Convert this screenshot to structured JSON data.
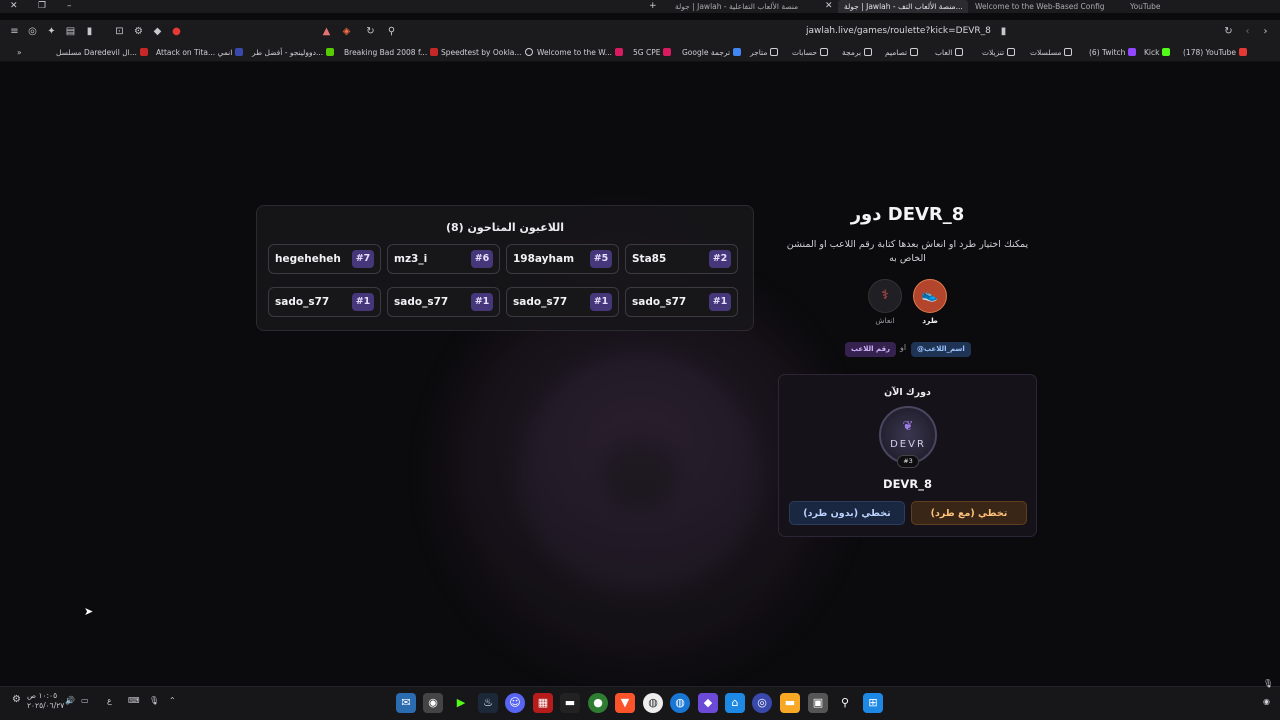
{
  "browser": {
    "tabs": [
      {
        "label": "YouTube",
        "active": false
      },
      {
        "label": "Welcome to the Web-Based Config...",
        "active": false
      },
      {
        "label": "جولة | Jawlah - منصة الألعاب التف...",
        "active": true
      },
      {
        "label": "جولة | Jawlah - منصة الألعاب التفاعلية",
        "active": false
      }
    ],
    "new_tab": "+",
    "url": "jawlah.live/games/roulette?kick=DEVR_8",
    "bookmarks": [
      {
        "label": "(178) YouTube",
        "color": "#e53935"
      },
      {
        "label": "Kick",
        "color": "#53fc18"
      },
      {
        "label": "(6) Twitch",
        "color": "#9146ff"
      },
      {
        "label": "مسلسلات",
        "color": "#cfcfd4"
      },
      {
        "label": "تنزيلات",
        "color": "#cfcfd4"
      },
      {
        "label": "العاب",
        "color": "#cfcfd4"
      },
      {
        "label": "تصاميم",
        "color": "#cfcfd4"
      },
      {
        "label": "برمجة",
        "color": "#cfcfd4"
      },
      {
        "label": "حسابات",
        "color": "#cfcfd4"
      },
      {
        "label": "متاجر",
        "color": "#cfcfd4"
      },
      {
        "label": "Google ترجمة",
        "color": "#4285f4"
      },
      {
        "label": "5G CPE",
        "color": "#d81b60"
      },
      {
        "label": "Welcome to the W...",
        "color": "#d81b60"
      },
      {
        "label": "Speedtest by Ookla...",
        "color": "#cfcfd4"
      },
      {
        "label": "Breaking Bad 2008 f...",
        "color": "#c62828"
      },
      {
        "label": "دوولينجو - أفضل طر...",
        "color": "#58cc02"
      },
      {
        "label": "Attack on Tita... انمي",
        "color": "#3949ab"
      },
      {
        "label": "مسلسل Daredevil ال...",
        "color": "#c62828"
      }
    ],
    "overflow": "»"
  },
  "game": {
    "players_panel": {
      "title": "اللاعبون المتاحون (8)",
      "players": [
        {
          "name": "Sta85",
          "number": "#2"
        },
        {
          "name": "198ayham",
          "number": "#5"
        },
        {
          "name": "mz3_i",
          "number": "#6"
        },
        {
          "name": "hegeheheh",
          "number": "#7"
        },
        {
          "name": "sado_s77",
          "number": "#1"
        },
        {
          "name": "sado_s77",
          "number": "#1"
        },
        {
          "name": "sado_s77",
          "number": "#1"
        },
        {
          "name": "sado_s77",
          "number": "#1"
        }
      ]
    },
    "turn": {
      "title": "دور DEVR_8",
      "hint": "يمكنك اختيار طرد او انعاش بعدها كتابة رقم اللاعب او المنشن الخاص به",
      "actions": [
        {
          "label": "طرد",
          "icon": "kick-shoe-icon",
          "active": true
        },
        {
          "label": "انعاش",
          "icon": "syringe-icon",
          "active": false
        }
      ],
      "tag_name": "@اسم_اللاعب",
      "or": "او",
      "tag_number": "رقم اللاعب"
    },
    "current": {
      "title": "دورك الآن",
      "avatar_text": "DEVR",
      "badge": "#3",
      "name": "DEVR_8",
      "skip_with_kick": "تخطي (مع طرد)",
      "skip_without_kick": "تخطي (بدون طرد)"
    }
  },
  "taskbar": {
    "time": "١٠:٠٥ ص",
    "date": "٢٠٢٥/٠٦/٢٧",
    "lang": "ع"
  }
}
